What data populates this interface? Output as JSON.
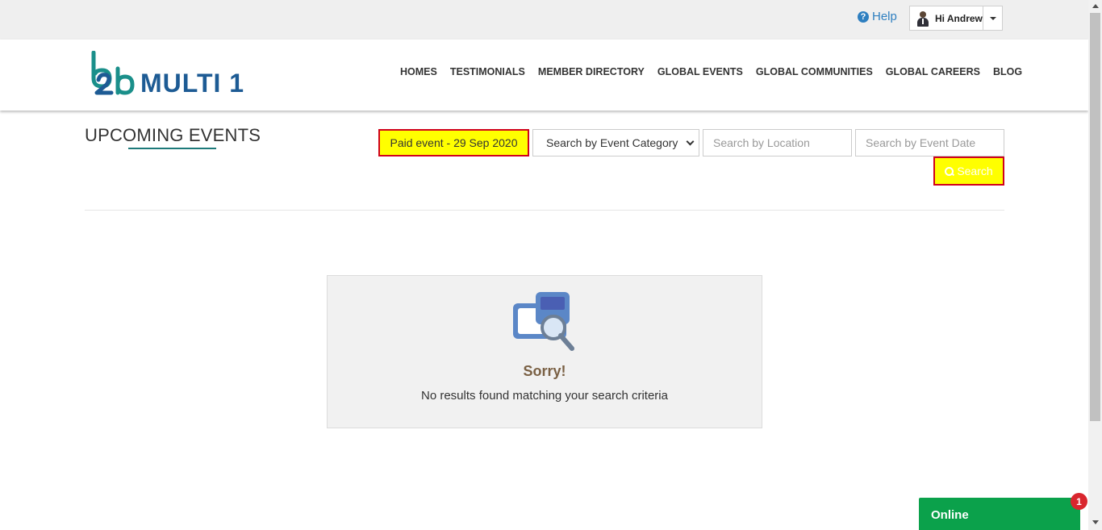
{
  "topbar": {
    "help_label": "Help",
    "help_icon": "question-circle-icon",
    "user_greeting": "Hi Andrew"
  },
  "header": {
    "logo_text": "MULTI 1",
    "nav": [
      "HOMES",
      "TESTIMONIALS",
      "MEMBER DIRECTORY",
      "GLOBAL EVENTS",
      "GLOBAL COMMUNITIES",
      "GLOBAL CAREERS",
      "BLOG"
    ]
  },
  "page": {
    "title": "UPCOMING EVENTS"
  },
  "filters": {
    "selected_tag": "Paid event - 29 Sep 2020",
    "category_select": "Search by Event Category",
    "location_placeholder": "Search by Location",
    "date_placeholder": "Search by Event Date",
    "search_label": "Search"
  },
  "empty_state": {
    "heading": "Sorry!",
    "message": "No results found matching your search criteria",
    "icon": "folder-search-icon"
  },
  "chat": {
    "status": "Online",
    "badge_count": "1"
  },
  "colors": {
    "highlight": "#ffff00",
    "highlight_border": "#d0021b",
    "brand_blue": "#1d5b94",
    "brand_teal": "#1d7a7a",
    "online_green": "#0ba14b"
  }
}
